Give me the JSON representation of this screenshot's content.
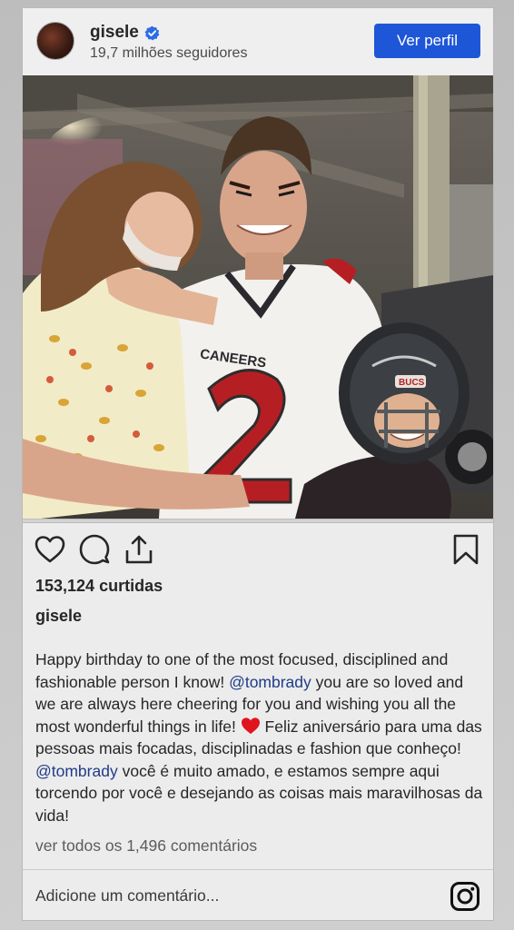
{
  "header": {
    "username": "gisele",
    "followers": "19,7 milhões seguidores",
    "view_profile_label": "Ver perfil",
    "verified_icon": "verified-badge-icon",
    "accent": "#1e56d8"
  },
  "post": {
    "image_alt": "photo",
    "likes": "153,124 curtidas",
    "caption_user": "gisele",
    "caption": {
      "part1": "Happy birthday to one of the most focused, disciplined and fashionable person I know! ",
      "mention1": "@tombrady",
      "part2": " you are so loved and we are always here cheering for you and wishing you all the most wonderful things in life! ",
      "part3": " Feliz aniversário para uma das pessoas mais focadas, disciplinadas e fashion que conheço! ",
      "mention2": "@tombrady",
      "part4": " você é muito amado, e estamos sempre aqui torcendo por você e desejando as coisas mais maravilhosas da vida!"
    },
    "view_comments": "ver todos os 1,496 comentários",
    "add_comment_placeholder": "Adicione um comentário..."
  },
  "icons": [
    "heart-icon",
    "comment-icon",
    "share-icon",
    "bookmark-icon",
    "instagram-icon",
    "red-heart-emoji"
  ],
  "colors": {
    "mention": "#1f3c88",
    "emoji_heart": "#e0141e"
  }
}
